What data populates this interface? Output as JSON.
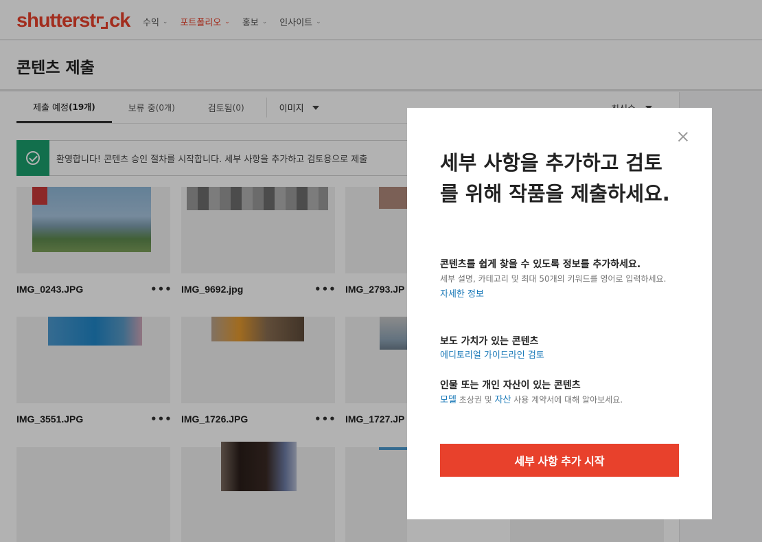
{
  "brand": {
    "logo_pre": "shutterst",
    "logo_post": "ck",
    "accent": "#e8412c"
  },
  "nav": [
    {
      "label": "수익",
      "active": false
    },
    {
      "label": "포트폴리오",
      "active": true
    },
    {
      "label": "홍보",
      "active": false
    },
    {
      "label": "인사이트",
      "active": false
    }
  ],
  "page": {
    "title": "콘텐츠 제출"
  },
  "tabs": [
    {
      "label": "제출 예정",
      "count": "(19개)",
      "active": true
    },
    {
      "label": "보류 중",
      "count": "(0개)",
      "active": false
    },
    {
      "label": "검토됨",
      "count": "(0)",
      "active": false
    }
  ],
  "filter": {
    "label": "이미지"
  },
  "sort": {
    "label": "최신순"
  },
  "banner": {
    "text": "환영합니다! 콘텐츠 승인 절차를 시작합니다. 세부 사항을 추가하고 검토용으로 제출",
    "color": "#1aa06d"
  },
  "files": [
    {
      "name": "IMG_0243.JPG"
    },
    {
      "name": "IMG_9692.jpg"
    },
    {
      "name": "IMG_2793.JP"
    },
    {
      "name": "IMG_3551.JPG"
    },
    {
      "name": "IMG_1726.JPG"
    },
    {
      "name": "IMG_1727.JP"
    }
  ],
  "more_label": "•••",
  "modal": {
    "title": "세부 사항을 추가하고 검토를 위해 작품을 제출하세요.",
    "sec1_heading": "콘텐츠를 쉽게 찾을 수 있도록 정보를 추가하세요.",
    "sec1_desc": "세부 설명, 카테고리 및 최대 50개의 키워드를 영어로 입력하세요.",
    "sec1_link": "자세한 정보",
    "sec2_heading": "보도 가치가 있는 콘텐츠",
    "sec2_link": "에디토리얼 가이드라인 검토",
    "sec3_heading": "인물 또는 개인 자산이 있는 콘텐츠",
    "sec3_link1": "모델",
    "sec3_text1": " 초상권 및 ",
    "sec3_link2": "자산",
    "sec3_text2": " 사용 계약서에 대해 알아보세요.",
    "cta": "세부 사항 추가 시작",
    "cta_color": "#e8412c",
    "link_color": "#1a79b8"
  }
}
